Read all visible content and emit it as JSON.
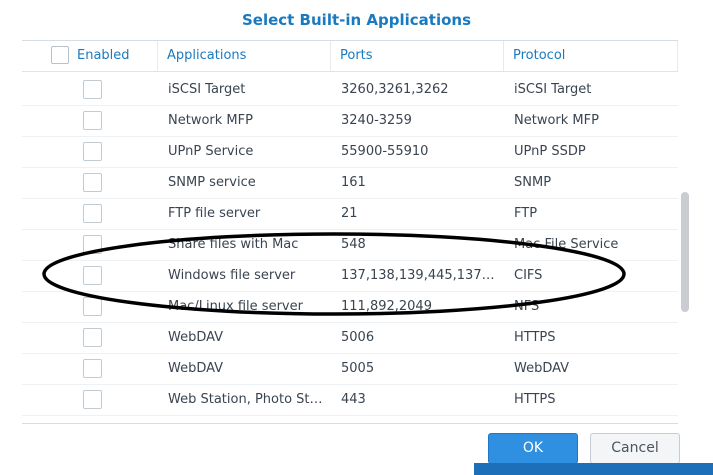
{
  "dialog": {
    "title": "Select Built-in Applications",
    "ok_label": "OK",
    "cancel_label": "Cancel"
  },
  "table": {
    "columns": {
      "enabled": "Enabled",
      "applications": "Applications",
      "ports": "Ports",
      "protocol": "Protocol"
    },
    "rows": [
      {
        "app": "iSCSI Target",
        "ports": "3260,3261,3262",
        "protocol": "iSCSI Target"
      },
      {
        "app": "Network MFP",
        "ports": "3240-3259",
        "protocol": "Network MFP"
      },
      {
        "app": "UPnP Service",
        "ports": "55900-55910",
        "protocol": "UPnP SSDP"
      },
      {
        "app": "SNMP service",
        "ports": "161",
        "protocol": "SNMP"
      },
      {
        "app": "FTP file server",
        "ports": "21",
        "protocol": "FTP"
      },
      {
        "app": "Share files with Mac",
        "ports": "548",
        "protocol": "Mac File Service"
      },
      {
        "app": "Windows file server",
        "ports": "137,138,139,445,137…",
        "protocol": "CIFS"
      },
      {
        "app": "Mac/Linux file server",
        "ports": "111,892,2049",
        "protocol": "NFS"
      },
      {
        "app": "WebDAV",
        "ports": "5006",
        "protocol": "HTTPS"
      },
      {
        "app": "WebDAV",
        "ports": "5005",
        "protocol": "WebDAV"
      },
      {
        "app": "Web Station, Photo St…",
        "ports": "443",
        "protocol": "HTTPS"
      }
    ]
  },
  "colors": {
    "accent": "#1a7ac0",
    "ok_button": "#2f8fe0",
    "annotation": "#000000"
  }
}
